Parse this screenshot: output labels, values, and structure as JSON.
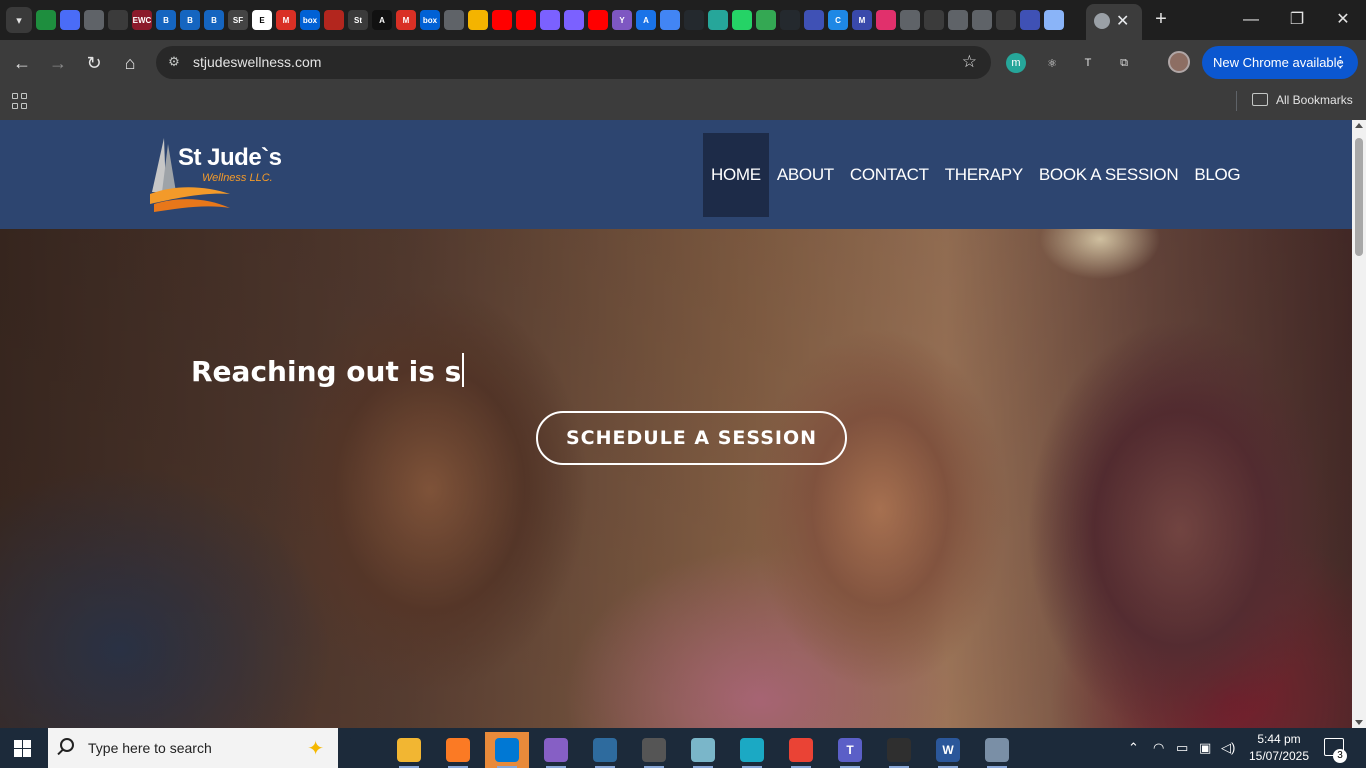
{
  "browser": {
    "tabs_pinned": [
      {
        "icon": "sheets-icon",
        "label": "",
        "color": "#1e8e3e"
      },
      {
        "icon": "clickup-icon",
        "label": "",
        "color": "#4a6cf7"
      },
      {
        "icon": "pen-icon",
        "label": "",
        "color": "#5f6368"
      },
      {
        "icon": "branch-icon",
        "label": "",
        "color": "#3b3b3b"
      },
      {
        "icon": "ewc-icon",
        "label": "EWC",
        "color": "#8b1a2b"
      },
      {
        "icon": "b-icon",
        "label": "B",
        "color": "#1565c0"
      },
      {
        "icon": "b-icon",
        "label": "B",
        "color": "#1565c0"
      },
      {
        "icon": "b-icon",
        "label": "B",
        "color": "#1565c0"
      },
      {
        "icon": "sf-icon",
        "label": "SF",
        "color": "#444444"
      },
      {
        "icon": "e-icon",
        "label": "E",
        "color": "#ffffff"
      },
      {
        "icon": "gmail-icon",
        "label": "M",
        "color": "#d93025"
      },
      {
        "icon": "box-icon",
        "label": "box",
        "color": "#0061d5"
      },
      {
        "icon": "red-circle-icon",
        "label": "",
        "color": "#b3261e"
      },
      {
        "icon": "st-icon",
        "label": "St",
        "color": "#3b3b3b"
      },
      {
        "icon": "a-icon",
        "label": "A",
        "color": "#111111"
      },
      {
        "icon": "gmail-icon",
        "label": "M",
        "color": "#d93025"
      },
      {
        "icon": "box-icon",
        "label": "box",
        "color": "#0061d5"
      },
      {
        "icon": "globe-icon",
        "label": "",
        "color": "#5f6368"
      },
      {
        "icon": "grid-color-icon",
        "label": "",
        "color": "#f4b400"
      },
      {
        "icon": "youtube-icon",
        "label": "",
        "color": "#ff0000"
      },
      {
        "icon": "youtube-icon",
        "label": "",
        "color": "#ff0000"
      },
      {
        "icon": "window-icon",
        "label": "",
        "color": "#7b61ff"
      },
      {
        "icon": "window-icon",
        "label": "",
        "color": "#7b61ff"
      },
      {
        "icon": "youtube-icon",
        "label": "",
        "color": "#ff0000"
      },
      {
        "icon": "y-icon",
        "label": "Y",
        "color": "#7e57c2"
      },
      {
        "icon": "a-icon",
        "label": "A",
        "color": "#1a73e8"
      },
      {
        "icon": "sparkle-icon",
        "label": "",
        "color": "#4285f4"
      },
      {
        "icon": "github-icon",
        "label": "",
        "color": "#24292e"
      },
      {
        "icon": "circle-icon",
        "label": "",
        "color": "#26a69a"
      },
      {
        "icon": "whatsapp-icon",
        "label": "",
        "color": "#25d366"
      },
      {
        "icon": "plus-circle-icon",
        "label": "",
        "color": "#34a853"
      },
      {
        "icon": "github-icon",
        "label": "",
        "color": "#24292e"
      },
      {
        "icon": "figure-icon",
        "label": "",
        "color": "#3f51b5"
      },
      {
        "icon": "c-icon",
        "label": "C",
        "color": "#1e88e5"
      },
      {
        "icon": "m-icon",
        "label": "M",
        "color": "#3949ab"
      },
      {
        "icon": "instagram-icon",
        "label": "",
        "color": "#e1306c"
      },
      {
        "icon": "chrome-icon",
        "label": "",
        "color": "#5f6368"
      },
      {
        "icon": "loading-icon",
        "label": "",
        "color": "#3b3b3b"
      },
      {
        "icon": "chrome-icon",
        "label": "",
        "color": "#5f6368"
      },
      {
        "icon": "chrome-icon",
        "label": "",
        "color": "#5f6368"
      },
      {
        "icon": "globe-icon",
        "label": "",
        "color": "#3b3b3b"
      },
      {
        "icon": "window-icon",
        "label": "",
        "color": "#3f51b5"
      },
      {
        "icon": "window-icon",
        "label": "",
        "color": "#8ab4f8"
      }
    ],
    "active_tab": {
      "close_label": "✕"
    },
    "new_tab_label": "+",
    "window_controls": {
      "minimize": "—",
      "maximize": "❐",
      "close": "✕"
    },
    "url": "stjudeswellness.com",
    "update_button": "New Chrome available",
    "bookmarks_all": "All Bookmarks"
  },
  "site": {
    "logo": {
      "name": "St Jude`s",
      "tagline": "Wellness LLC."
    },
    "nav": [
      {
        "label": "HOME"
      },
      {
        "label": "ABOUT"
      },
      {
        "label": "CONTACT"
      },
      {
        "label": "THERAPY"
      },
      {
        "label": "BOOK A SESSION"
      },
      {
        "label": "BLOG"
      }
    ],
    "hero": {
      "title": "Reaching out is s",
      "cta": "SCHEDULE A SESSION"
    }
  },
  "taskbar": {
    "search_placeholder": "Type here to search",
    "clock_time": "5:44 pm",
    "clock_date": "15/07/2025",
    "notification_count": "3",
    "apps": [
      {
        "icon": "task-view-icon",
        "label": "",
        "color": "#1c2a3a"
      },
      {
        "icon": "file-explorer-icon",
        "label": "",
        "color": "#f2b632"
      },
      {
        "icon": "xampp-icon",
        "label": "",
        "color": "#fb7a24"
      },
      {
        "icon": "vscode-icon",
        "label": "",
        "color": "#0078d4"
      },
      {
        "icon": "visual-studio-icon",
        "label": "",
        "color": "#865fc5"
      },
      {
        "icon": "mysql-workbench-icon",
        "label": "",
        "color": "#2e6b9e"
      },
      {
        "icon": "spy-icon",
        "label": "",
        "color": "#555555"
      },
      {
        "icon": "notes-icon",
        "label": "",
        "color": "#7ab6c9"
      },
      {
        "icon": "edge-icon",
        "label": "",
        "color": "#1ba9c4"
      },
      {
        "icon": "chrome-icon",
        "label": "",
        "color": "#ea4335"
      },
      {
        "icon": "teams-icon",
        "label": "T",
        "color": "#5b5fc7"
      },
      {
        "icon": "snipping-tool-icon",
        "label": "",
        "color": "#2f2f2f"
      },
      {
        "icon": "word-icon",
        "label": "W",
        "color": "#2b579a"
      },
      {
        "icon": "network-tool-icon",
        "label": "",
        "color": "#7a8fa6"
      }
    ]
  }
}
